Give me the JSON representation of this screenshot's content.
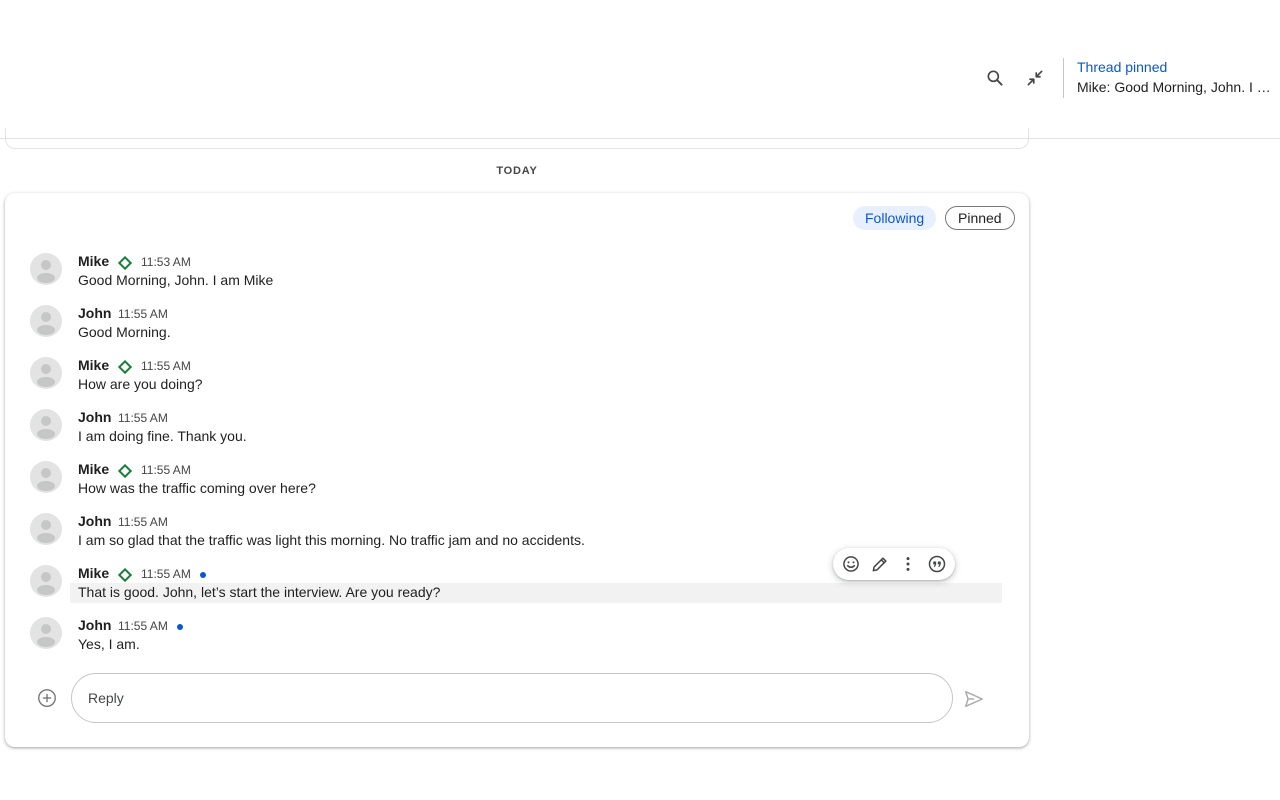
{
  "header": {
    "search_icon": "search-icon",
    "collapse_icon": "collapse-arrows-icon",
    "pinned_notice": {
      "title": "Thread pinned",
      "preview": "Mike: Good Morning, John. I am Mike"
    }
  },
  "date_divider": "TODAY",
  "thread": {
    "filters": {
      "following": "Following",
      "pinned": "Pinned"
    },
    "messages": [
      {
        "sender": "Mike",
        "verified": true,
        "time": "11:53 AM",
        "text": "Good Morning, John. I am Mike",
        "unread": false
      },
      {
        "sender": "John",
        "verified": false,
        "time": "11:55 AM",
        "text": "Good Morning.",
        "unread": false
      },
      {
        "sender": "Mike",
        "verified": true,
        "time": "11:55 AM",
        "text": "How are you doing?",
        "unread": false
      },
      {
        "sender": "John",
        "verified": false,
        "time": "11:55 AM",
        "text": "I am doing fine. Thank you.",
        "unread": false
      },
      {
        "sender": "Mike",
        "verified": true,
        "time": "11:55 AM",
        "text": "How was the traffic coming over here?",
        "unread": false
      },
      {
        "sender": "John",
        "verified": false,
        "time": "11:55 AM",
        "text": "I am so glad that the traffic was light this morning. No traffic jam and no accidents.",
        "unread": false
      },
      {
        "sender": "Mike",
        "verified": true,
        "time": "11:55 AM",
        "text": "That is good. John, let’s start the interview. Are you ready?",
        "unread": true
      },
      {
        "sender": "John",
        "verified": false,
        "time": "11:55 AM",
        "text": "Yes, I am.",
        "unread": true
      }
    ],
    "hover_toolbar": [
      "emoji-icon",
      "edit-pencil-icon",
      "more-vert-icon",
      "quote-icon"
    ]
  },
  "composer": {
    "placeholder": "Reply",
    "value": ""
  },
  "colors": {
    "accent": "#0b57d0",
    "verified": "#188038",
    "chip_bg": "#e8f0fe"
  }
}
